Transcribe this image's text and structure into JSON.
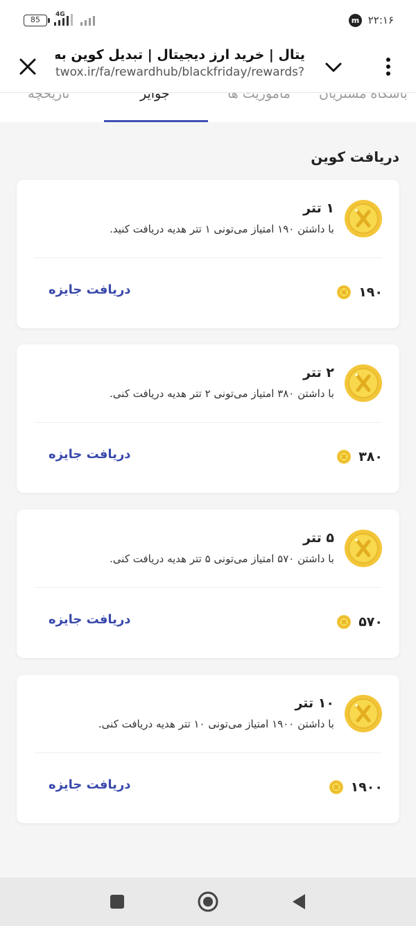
{
  "status_bar": {
    "battery": "85",
    "network": "4G",
    "time": "۲۲:۱۶",
    "app_badge": "m"
  },
  "browser": {
    "title": "یتال | خرید ارز دیجیتال | تبدیل کوین به",
    "url": "twox.ir/fa/rewardhub/blackfriday/rewards?",
    "close_icon": "close-icon",
    "chevron_icon": "chevron-down-icon",
    "menu_icon": "more-vertical-icon"
  },
  "tabs": [
    {
      "label": "باشگاه مشتریان",
      "active": false
    },
    {
      "label": "ماموریت ها",
      "active": false
    },
    {
      "label": "جوایز",
      "active": true
    },
    {
      "label": "تاریخچه",
      "active": false
    }
  ],
  "section": {
    "title": "دریافت کوین"
  },
  "rewards": [
    {
      "title": "۱ تتر",
      "description": "با داشتن ۱۹۰ امتیاز می‌تونی ۱ تتر هدیه دریافت کنید.",
      "cost": "۱۹۰",
      "claim_label": "دریافت جایزه"
    },
    {
      "title": "۲ تتر",
      "description": "با داشتن ۳۸۰ امتیاز می‌تونی ۲ تتر هدیه دریافت کنی.",
      "cost": "۳۸۰",
      "claim_label": "دریافت جایزه"
    },
    {
      "title": "۵ تتر",
      "description": "با داشتن ۵۷۰ امتیاز می‌تونی ۵ تتر هدیه دریافت کنی.",
      "cost": "۵۷۰",
      "claim_label": "دریافت جایزه"
    },
    {
      "title": "۱۰ تتر",
      "description": "با داشتن ۱۹۰۰ امتیاز می‌تونی ۱۰ تتر هدیه دریافت کنی.",
      "cost": "۱۹۰۰",
      "claim_label": "دریافت جایزه"
    }
  ],
  "colors": {
    "accent": "#3f51b5",
    "link": "#3949ab",
    "coin": "#f6d33c",
    "background": "#f5f5f6"
  },
  "nav": {
    "icons": [
      "recent-apps-icon",
      "home-icon",
      "back-icon"
    ]
  }
}
